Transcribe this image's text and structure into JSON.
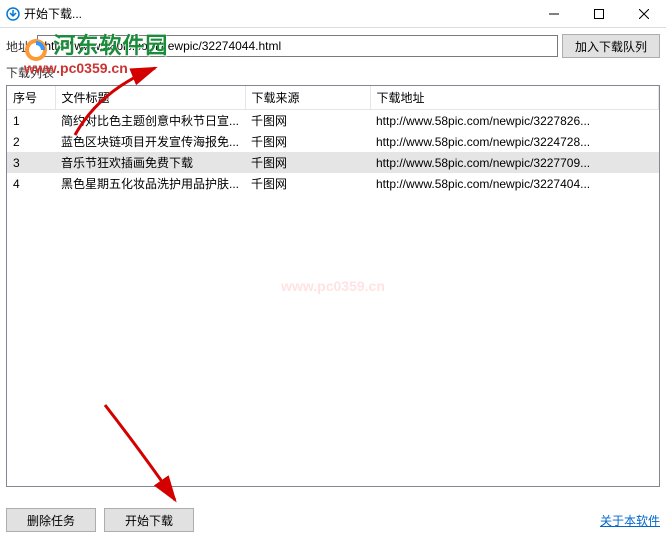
{
  "titlebar": {
    "title": "开始下载..."
  },
  "address": {
    "label": "地址:",
    "value": "http://www.58pic.com/newpic/32274044.html",
    "button": "加入下载队列"
  },
  "watermark": {
    "title": "河东软件园",
    "url": "www.pc0359.cn"
  },
  "list": {
    "label": "下载列表"
  },
  "table": {
    "headers": {
      "seq": "序号",
      "title": "文件标题",
      "source": "下载来源",
      "url": "下载地址"
    },
    "rows": [
      {
        "seq": "1",
        "title": "简约对比色主题创意中秋节日宣...",
        "source": "千图网",
        "url": "http://www.58pic.com/newpic/3227826..."
      },
      {
        "seq": "2",
        "title": "蓝色区块链项目开发宣传海报免...",
        "source": "千图网",
        "url": "http://www.58pic.com/newpic/3224728..."
      },
      {
        "seq": "3",
        "title": "音乐节狂欢插画免费下载",
        "source": "千图网",
        "url": "http://www.58pic.com/newpic/3227709...",
        "selected": true
      },
      {
        "seq": "4",
        "title": "黑色星期五化妆品洗护用品护肤...",
        "source": "千图网",
        "url": "http://www.58pic.com/newpic/3227404..."
      }
    ]
  },
  "center_wm": "www.pc0359.cn",
  "buttons": {
    "delete": "删除任务",
    "start": "开始下载"
  },
  "about": "关于本软件"
}
